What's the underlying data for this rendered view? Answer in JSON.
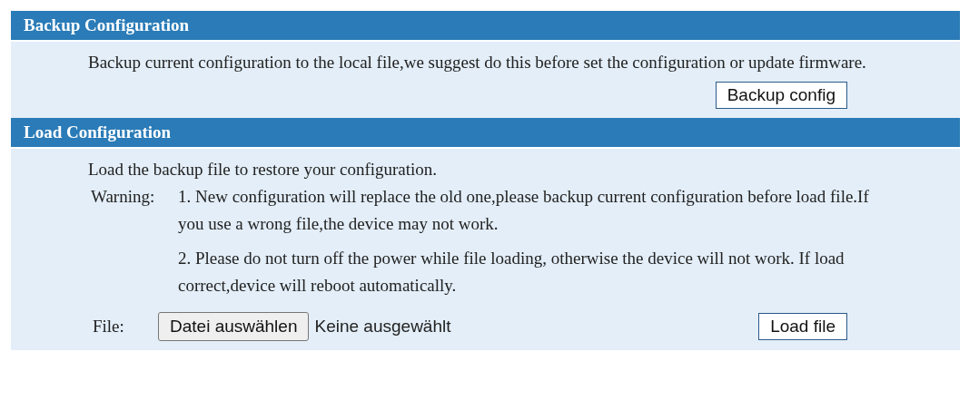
{
  "sections": [
    {
      "title": "Backup Configuration",
      "kind": "backup",
      "description": "Backup current configuration to the local file,we suggest do this before set the configuration or update firmware.",
      "button": "Backup config"
    },
    {
      "title": "Load Configuration",
      "kind": "load",
      "description": "Load the backup file to restore your configuration.",
      "warning_label": "Warning:",
      "warnings": [
        "1. New configuration will replace the old one,please backup current configuration before load file.If you use a wrong file,the device may not work.",
        "2. Please do not turn off the power while file loading, otherwise the device will not work. If load correct,device will reboot automatically."
      ],
      "file_label": "File:",
      "file_button": "Datei auswählen",
      "file_status": "Keine ausgewählt",
      "button": "Load file"
    }
  ]
}
